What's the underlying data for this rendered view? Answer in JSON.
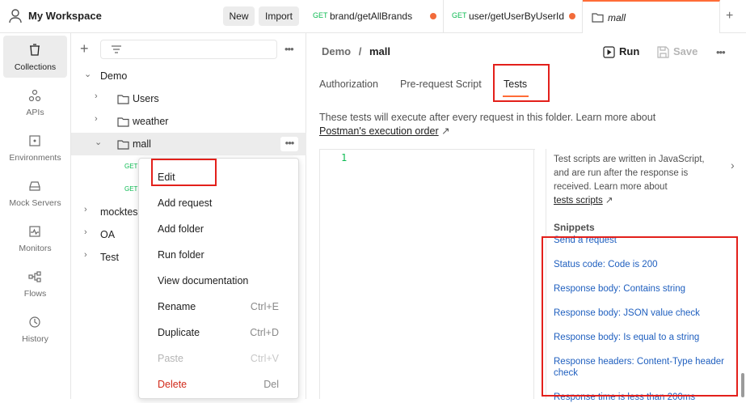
{
  "workspace": {
    "title": "My Workspace",
    "new_label": "New",
    "import_label": "Import"
  },
  "tabs": [
    {
      "method": "GET",
      "title": "brand/getAllBrands"
    },
    {
      "method": "GET",
      "title": "user/getUserByUserId"
    },
    {
      "title": "mall"
    }
  ],
  "sidebar": [
    {
      "label": "Collections",
      "icon": "collections-icon"
    },
    {
      "label": "APIs",
      "icon": "apis-icon"
    },
    {
      "label": "Environments",
      "icon": "environments-icon"
    },
    {
      "label": "Mock Servers",
      "icon": "mock-servers-icon"
    },
    {
      "label": "Monitors",
      "icon": "monitors-icon"
    },
    {
      "label": "Flows",
      "icon": "flows-icon"
    },
    {
      "label": "History",
      "icon": "history-icon"
    }
  ],
  "tree": {
    "root": "Demo",
    "folders": [
      "Users",
      "weather",
      "mall"
    ],
    "mall_children": [
      "GET",
      "GET"
    ],
    "collections": [
      "mocktes",
      "OA",
      "Test"
    ]
  },
  "menu": [
    {
      "label": "Edit",
      "shortcut": ""
    },
    {
      "label": "Add request",
      "shortcut": ""
    },
    {
      "label": "Add folder",
      "shortcut": ""
    },
    {
      "label": "Run folder",
      "shortcut": ""
    },
    {
      "label": "View documentation",
      "shortcut": ""
    },
    {
      "label": "Rename",
      "shortcut": "Ctrl+E"
    },
    {
      "label": "Duplicate",
      "shortcut": "Ctrl+D"
    },
    {
      "label": "Paste",
      "shortcut": "Ctrl+V"
    },
    {
      "label": "Delete",
      "shortcut": "Del"
    }
  ],
  "main": {
    "crumb_parent": "Demo",
    "crumb_sep": "/",
    "crumb_current": "mall",
    "run_label": "Run",
    "save_label": "Save",
    "subtabs": [
      "Authorization",
      "Pre-request Script",
      "Tests"
    ],
    "desc_text": "These tests will execute after every request in this folder. Learn more about",
    "desc_link": "Postman's execution order",
    "link_arrow": "↗",
    "line_number": "1",
    "help_text": "Test scripts are written in JavaScript, and are run after the response is received. Learn more about",
    "help_link": "tests scripts",
    "snippets_title": "Snippets",
    "snippets": [
      "Send a request",
      "Status code: Code is 200",
      "Response body: Contains string",
      "Response body: JSON value check",
      "Response body: Is equal to a string",
      "Response headers: Content-Type header check",
      "Response time is less than 200ms"
    ]
  },
  "colors": {
    "accent": "#ff6c37",
    "get_method": "#0cbb52",
    "highlight_box": "#e3201b",
    "snippet_link": "#1f5fbf"
  }
}
